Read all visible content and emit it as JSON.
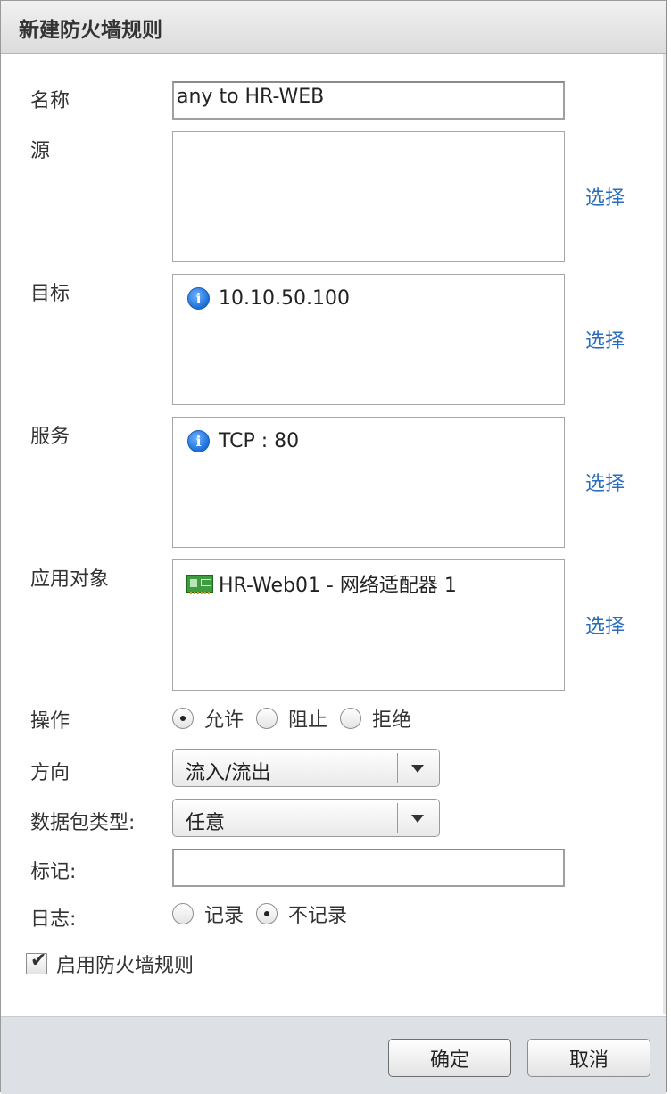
{
  "dialog": {
    "title": "新建防火墙规则"
  },
  "form": {
    "name": {
      "label": "名称",
      "value": "any to HR-WEB"
    },
    "source": {
      "label": "源",
      "items": [],
      "select_label": "选择"
    },
    "destination": {
      "label": "目标",
      "items": [
        {
          "icon": "info-icon",
          "text": "10.10.50.100"
        }
      ],
      "select_label": "选择"
    },
    "service": {
      "label": "服务",
      "items": [
        {
          "icon": "info-icon",
          "text": "TCP : 80"
        }
      ],
      "select_label": "选择"
    },
    "applied_to": {
      "label": "应用对象",
      "items": [
        {
          "icon": "network-adapter-icon",
          "text": "HR-Web01 - 网络适配器 1"
        }
      ],
      "select_label": "选择"
    },
    "action": {
      "label": "操作",
      "options": [
        "允许",
        "阻止",
        "拒绝"
      ],
      "selected": "允许"
    },
    "direction": {
      "label": "方向",
      "value": "流入/流出"
    },
    "packet_type": {
      "label": "数据包类型:",
      "value": "任意"
    },
    "tag": {
      "label": "标记:",
      "value": ""
    },
    "log": {
      "label": "日志:",
      "options": [
        "记录",
        "不记录"
      ],
      "selected": "不记录"
    },
    "enable": {
      "label": "启用防火墙规则",
      "checked": true
    }
  },
  "footer": {
    "ok_label": "确定",
    "cancel_label": "取消"
  },
  "colors": {
    "link": "#2a6ebb",
    "footer_bg": "#dde0e4",
    "title_bg": "#e6e6e6"
  }
}
